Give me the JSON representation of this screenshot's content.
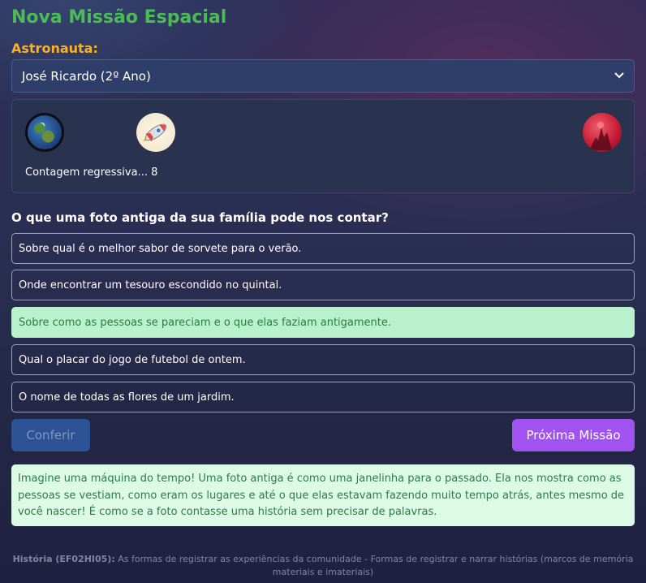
{
  "title": "Nova Missão Espacial",
  "astronaut": {
    "label": "Astronauta:",
    "selected": "José Ricardo (2º Ano)"
  },
  "journey": {
    "icons": [
      "earth-icon",
      "rocket-icon",
      "mars-icon"
    ],
    "countdown_text": "Contagem regressiva... 8"
  },
  "question": "O que uma foto antiga da sua família pode nos contar?",
  "options": [
    "Sobre qual é o melhor sabor de sorvete para o verão.",
    "Onde encontrar um tesouro escondido no quintal.",
    "Sobre como as pessoas se pareciam e o que elas faziam antigamente.",
    "Qual o placar do jogo de futebol de ontem.",
    "O nome de todas as flores de um jardim."
  ],
  "buttons": {
    "check": "Conferir",
    "next": "Próxima Missão"
  },
  "explanation": "Imagine uma máquina do tempo! Uma foto antiga é como uma janelinha para o passado. Ela nos mostra como as pessoas se vestiam, como eram os lugares e até o que elas estavam fazendo muito tempo atrás, antes mesmo de você nascer! É como se a foto contasse uma história sem precisar de palavras.",
  "footer": {
    "subject": "História (EF02HI05):",
    "text": " As formas de registrar as experiências da comunidade - Formas de registrar e narrar histórias (marcos de memória materiais e imateriais)"
  },
  "colors": {
    "title": "#4cbb55",
    "label": "#f5b22a",
    "correct_bg": "#b9f1cd",
    "next_button": "#a252f0",
    "check_button": "#2e5296"
  }
}
